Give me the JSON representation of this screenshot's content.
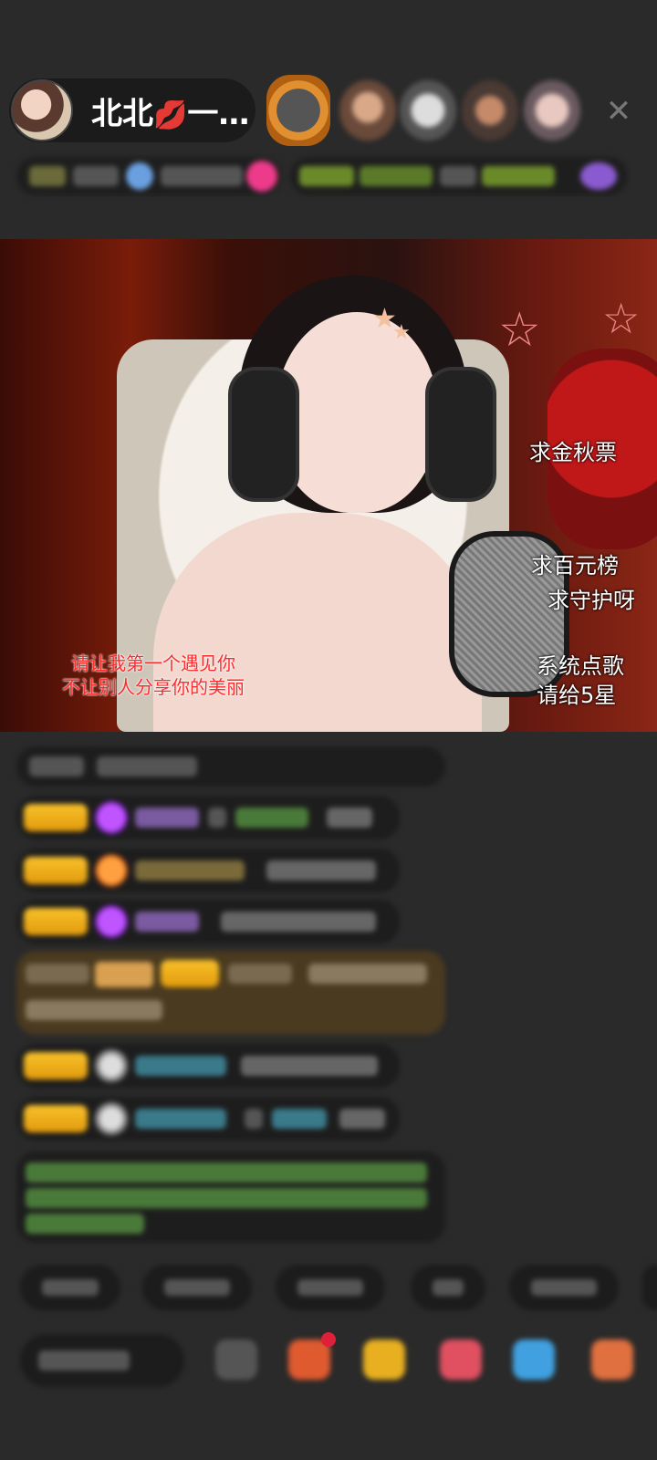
{
  "header": {
    "host_name": "北北",
    "host_name_suffix": "一…",
    "lips_icon": "kiss-lips-icon",
    "close_icon": "close-icon"
  },
  "video": {
    "overlay_right": [
      "求金秋票",
      "求百元榜",
      "求守护呀",
      "系统点歌",
      "请给5星"
    ],
    "overlay_bottom_left": [
      "请让我第一个遇见你",
      "不让别人分享你的美丽"
    ]
  },
  "colors": {
    "badge_gold": "#f4b21c",
    "background": "#2a2a2a",
    "chat_green": "#7ec94a",
    "chat_teal": "#4fb0b8",
    "lips_red": "#e0203a",
    "overlay_red": "#ff2a2a"
  }
}
